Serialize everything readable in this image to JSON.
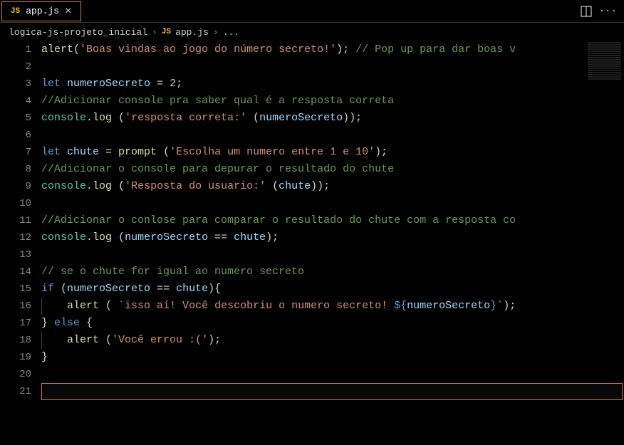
{
  "tab": {
    "iconText": "JS",
    "label": "app.js",
    "close": "×"
  },
  "breadcrumb": {
    "folder": "logica-js-projeto_inicial",
    "sep": "›",
    "fileIcon": "JS",
    "file": "app.js",
    "ellipsis": "..."
  },
  "actions": {
    "more": "···"
  },
  "gutter": {
    "lines": [
      "1",
      "2",
      "3",
      "4",
      "5",
      "6",
      "7",
      "8",
      "9",
      "10",
      "11",
      "12",
      "13",
      "14",
      "15",
      "16",
      "17",
      "18",
      "19",
      "20",
      "21"
    ]
  },
  "code": {
    "l1": {
      "fn": "alert",
      "p1": "(",
      "s": "'Boas vindas ao jogo do número secreto!'",
      "p2": "); ",
      "c": "// Pop up para dar boas v"
    },
    "l3": {
      "kw": "let ",
      "v": "numeroSecreto ",
      "op": "= ",
      "n": "2",
      "p": ";"
    },
    "l4": {
      "c": "//Adicionar console pra saber qual é a resposta correta"
    },
    "l5": {
      "o": "console",
      "dot": ".",
      "m": "log ",
      "p1": "(",
      "s": "'resposta correta:' ",
      "p2": "(",
      "v": "numeroSecreto",
      "p3": "));"
    },
    "l7": {
      "kw": "let ",
      "v": "chute ",
      "op": "= ",
      "fn": "prompt ",
      "p1": "(",
      "s": "'Escolha um numero entre 1 e 10'",
      "p2": ");"
    },
    "l8": {
      "c": "//Adicionar o console para depurar o resultado do chute"
    },
    "l9": {
      "o": "console",
      "dot": ".",
      "m": "log ",
      "p1": "(",
      "s": "'Resposta do usuario:' ",
      "p2": "(",
      "v": "chute",
      "p3": "));"
    },
    "l11": {
      "c": "//Adicionar o conlose para comparar o resultado do chute com a resposta co"
    },
    "l12": {
      "o": "console",
      "dot": ".",
      "m": "log ",
      "p1": "(",
      "v1": "numeroSecreto ",
      "op": "== ",
      "v2": "chute",
      "p2": ");"
    },
    "l14": {
      "c": "// se o chute for igual ao numero secreto"
    },
    "l15": {
      "kw": "if ",
      "p1": "(",
      "v1": "numeroSecreto ",
      "op": "== ",
      "v2": "chute",
      "p2": "){"
    },
    "l16": {
      "fn": "alert ",
      "p1": "( ",
      "s1": "`isso aí! Você descobriu o numero secreto! ",
      "tp1": "${",
      "v": "numeroSecreto",
      "tp2": "}",
      "s2": "`",
      "p2": ");"
    },
    "l17": {
      "p1": "} ",
      "kw": "else ",
      "p2": "{"
    },
    "l18": {
      "fn": "alert ",
      "p1": "(",
      "s": "'Você errou :('",
      "p2": ");"
    },
    "l19": {
      "p": "}"
    }
  }
}
